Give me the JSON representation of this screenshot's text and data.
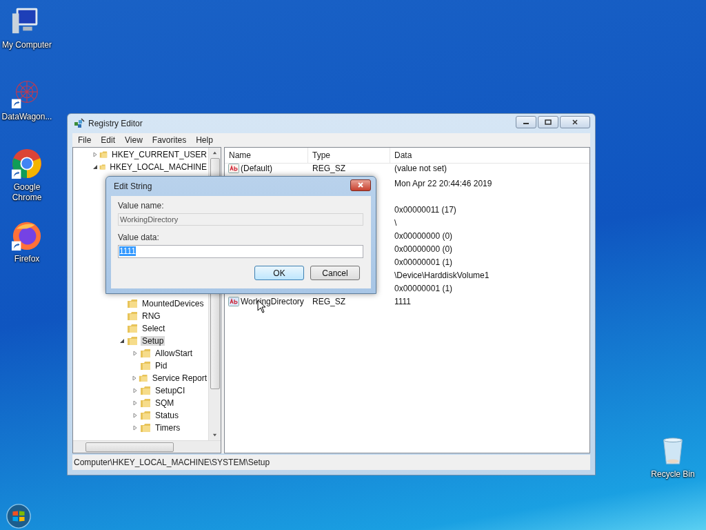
{
  "desktop_icons": [
    {
      "label": "My Computer",
      "kind": "computer",
      "shortcut": false
    },
    {
      "label": "DataWagon...",
      "kind": "star",
      "shortcut": true
    },
    {
      "label": "Google Chrome",
      "kind": "chrome",
      "shortcut": true
    },
    {
      "label": "Firefox",
      "kind": "firefox",
      "shortcut": true
    },
    {
      "label": "Recycle Bin",
      "kind": "bin",
      "shortcut": false
    }
  ],
  "window": {
    "title": "Registry Editor",
    "menu": [
      "File",
      "Edit",
      "View",
      "Favorites",
      "Help"
    ],
    "tree": [
      {
        "label": "HKEY_CURRENT_USER",
        "expanded": false,
        "selected": false
      },
      {
        "label": "HKEY_LOCAL_MACHINE",
        "expanded": true,
        "selected": false,
        "children": [
          {
            "label": "MountedDevices",
            "selected": false
          },
          {
            "label": "RNG",
            "selected": false
          },
          {
            "label": "Select",
            "selected": false
          },
          {
            "label": "Setup",
            "expanded": true,
            "selected": true,
            "children": [
              {
                "label": "AllowStart",
                "expanded": false,
                "selected": false
              },
              {
                "label": "Pid",
                "selected": false
              },
              {
                "label": "Service Report",
                "expanded": false,
                "selected": false
              },
              {
                "label": "SetupCI",
                "expanded": false,
                "selected": false
              },
              {
                "label": "SQM",
                "expanded": false,
                "selected": false
              },
              {
                "label": "Status",
                "expanded": false,
                "selected": false
              },
              {
                "label": "Timers",
                "expanded": false,
                "selected": false
              }
            ]
          }
        ]
      }
    ],
    "columns": [
      "Name",
      "Type",
      "Data"
    ],
    "rows": [
      {
        "kind": "string",
        "name": "(Default)",
        "type": "REG_SZ",
        "data": "(value not set)"
      },
      {
        "data": "Mon Apr 22 20:44:46 2019"
      },
      {},
      {
        "data": "0x00000011 (17)"
      },
      {
        "data": "\\"
      },
      {
        "data": "0x00000000 (0)"
      },
      {
        "data": "0x00000000 (0)"
      },
      {
        "data": "0x00000001 (1)"
      },
      {
        "data": "\\Device\\HarddiskVolume1"
      },
      {
        "data": "0x00000001 (1)"
      },
      {
        "kind": "string",
        "name": "WorkingDirectory",
        "type": "REG_SZ",
        "data": "1111"
      }
    ],
    "status_bar": "Computer\\HKEY_LOCAL_MACHINE\\SYSTEM\\Setup"
  },
  "dialog": {
    "title": "Edit String",
    "name_label": "Value name:",
    "name_value": "WorkingDirectory",
    "data_label": "Value data:",
    "data_value": "1111",
    "buttons": [
      "OK",
      "Cancel"
    ]
  }
}
